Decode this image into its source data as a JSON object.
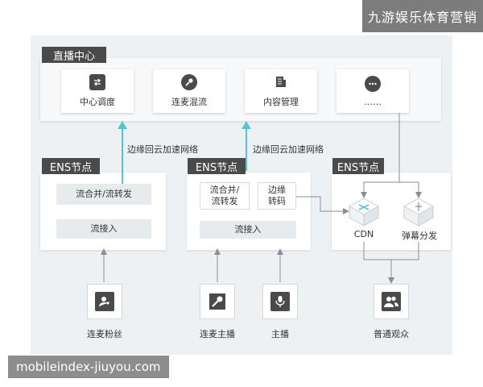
{
  "watermarks": {
    "top": "九游娱乐体育营销",
    "bottom": "mobileindex-jiuyou.com"
  },
  "center": {
    "label": "直播中心",
    "cards": [
      "中心调度",
      "连麦混流",
      "内容管理",
      "……"
    ]
  },
  "edges": {
    "accelerate_1": "边缘回云加速网络",
    "accelerate_2": "边缘回云加速网络"
  },
  "node1": {
    "label": "ENS节点",
    "merge": "流合并/流转发",
    "ingest": "流接入"
  },
  "node2": {
    "label": "ENS节点",
    "merge_line1": "流合并/",
    "merge_line2": "流转发",
    "transcode_line1": "边缘",
    "transcode_line2": "转码",
    "ingest": "流接入"
  },
  "node3": {
    "label": "ENS节点",
    "cdn": "CDN",
    "danmaku": "弹幕分发"
  },
  "clients": [
    "连麦粉丝",
    "连麦主播",
    "主播",
    "普通观众"
  ],
  "colors": {
    "accent": "#5bc2d6",
    "dark": "#4a4a4a",
    "line": "#8a8f93"
  }
}
